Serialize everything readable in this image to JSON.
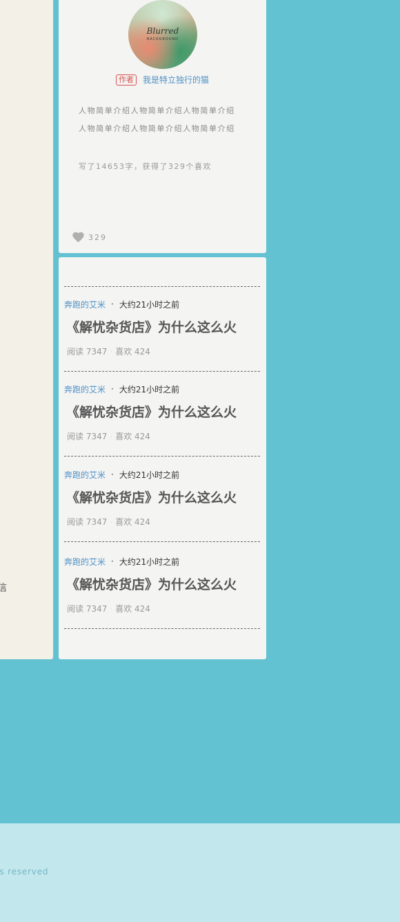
{
  "left_panel": {
    "visible_char": "信"
  },
  "author": {
    "avatar_logo": {
      "line1": "Blurred",
      "line2": "BACKGROUND"
    },
    "badge": "作者",
    "name": "我是特立独行的猫",
    "bio": "人物简单介绍人物简单介绍人物简单介绍人物简单介绍人物简单介绍人物简单介绍",
    "stats": "写了14653字，获得了329个喜欢",
    "likes": "329",
    "heart_icon": "heart-icon"
  },
  "articles": [
    {
      "author": "奔跑的艾米",
      "dot": "·",
      "time": "大约21小时之前",
      "title": "《解忧杂货店》为什么这么火",
      "reads": "阅读 7347",
      "sep": "·",
      "likes": "喜欢 424"
    },
    {
      "author": "奔跑的艾米",
      "dot": "·",
      "time": "大约21小时之前",
      "title": "《解忧杂货店》为什么这么火",
      "reads": "阅读 7347",
      "sep": "·",
      "likes": "喜欢 424"
    },
    {
      "author": "奔跑的艾米",
      "dot": "·",
      "time": "大约21小时之前",
      "title": "《解忧杂货店》为什么这么火",
      "reads": "阅读 7347",
      "sep": "·",
      "likes": "喜欢 424"
    },
    {
      "author": "奔跑的艾米",
      "dot": "·",
      "time": "大约21小时之前",
      "title": "《解忧杂货店》为什么这么火",
      "reads": "阅读 7347",
      "sep": "·",
      "likes": "喜欢 424"
    }
  ],
  "footer": {
    "text": "ts reserved"
  },
  "colors": {
    "page_bg": "#63c2d1",
    "card_bg": "#f4f4f3",
    "link": "#4f91c4",
    "badge": "#d9534f",
    "footer_bg": "#c2e7ed",
    "footer_text": "#76b6c4"
  }
}
